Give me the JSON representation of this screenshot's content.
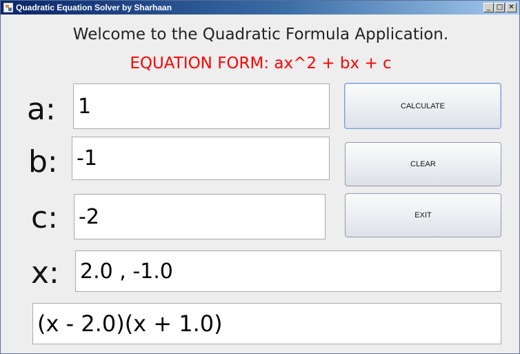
{
  "window": {
    "title": "Quadratic Equation Solver by Sharhaan",
    "controls": {
      "minimize": "_",
      "maximize": "□",
      "close": "✕"
    }
  },
  "header": {
    "welcome": "Welcome to the Quadratic Formula Application.",
    "equation_form": "EQUATION FORM: ax^2 + bx + c"
  },
  "inputs": {
    "a": {
      "label": "a:",
      "value": "1"
    },
    "b": {
      "label": "b:",
      "value": "-1"
    },
    "c": {
      "label": "c:",
      "value": "-2"
    }
  },
  "outputs": {
    "x": {
      "label": "x:",
      "value": "2.0 , -1.0"
    },
    "factored": "(x - 2.0)(x + 1.0)"
  },
  "buttons": {
    "calculate": "CALCULATE",
    "clear": "CLEAR",
    "exit": "EXIT"
  },
  "colors": {
    "equation_form_text": "#ff0000",
    "titlebar_start": "#0a246a",
    "titlebar_end": "#a6caf0",
    "background": "#eeeeee"
  }
}
